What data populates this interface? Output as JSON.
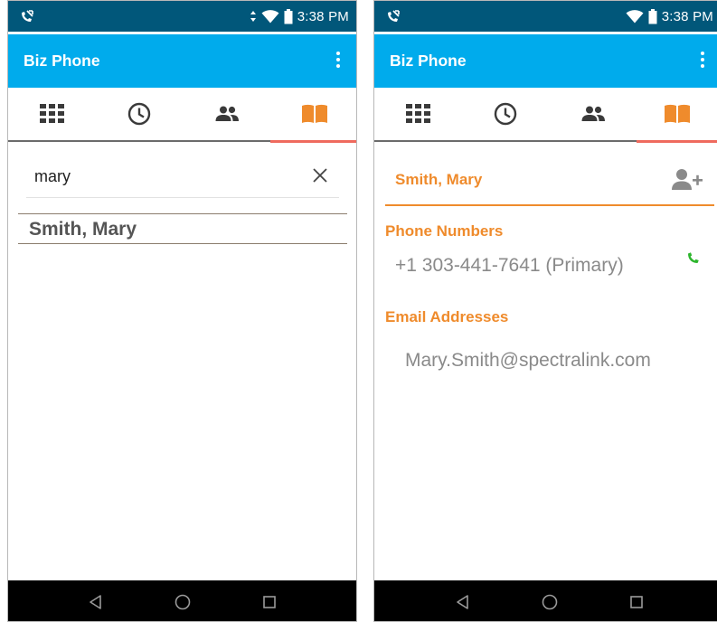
{
  "screens": [
    {
      "status": {
        "time": "3:38 PM"
      },
      "app_bar": {
        "title": "Biz Phone"
      },
      "tabs": [
        {
          "icon": "dialpad-icon"
        },
        {
          "icon": "recents-clock-icon"
        },
        {
          "icon": "contacts-people-icon"
        },
        {
          "icon": "directory-book-icon",
          "active": true
        }
      ],
      "search": {
        "value": "mary",
        "placeholder": ""
      },
      "results": [
        {
          "name": "Smith, Mary"
        }
      ]
    },
    {
      "status": {
        "time": "3:38 PM"
      },
      "app_bar": {
        "title": "Biz Phone"
      },
      "tabs": [
        {
          "icon": "dialpad-icon"
        },
        {
          "icon": "recents-clock-icon"
        },
        {
          "icon": "contacts-people-icon"
        },
        {
          "icon": "directory-book-icon",
          "active": true
        }
      ],
      "contact": {
        "name": "Smith, Mary",
        "phone_label": "Phone Numbers",
        "phone_number": "+1 303-441-7641 (Primary)",
        "email_label": "Email Addresses",
        "email": "Mary.Smith@spectralink.com"
      }
    }
  ],
  "colors": {
    "status_bar": "#01577a",
    "app_bar": "#00abec",
    "accent_orange": "#ef8b2c",
    "tab_indicator": "#ef6a5e",
    "call_green": "#2db52d",
    "icon_dark": "#3a3a3a"
  }
}
